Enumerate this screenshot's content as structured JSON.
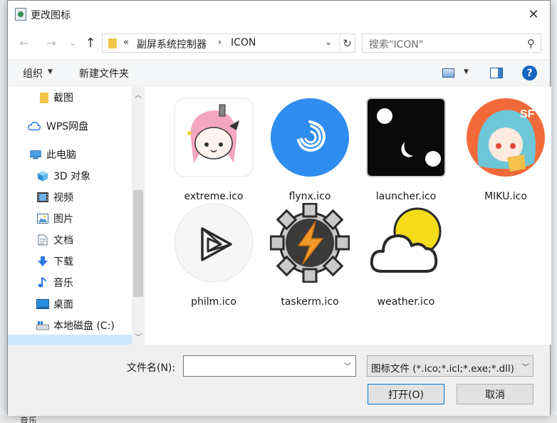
{
  "window": {
    "title": "更改图标"
  },
  "navigation": {
    "back_icon": "←",
    "forward_icon": "→",
    "recent_icon": "⌄",
    "up_icon": "↑"
  },
  "address": {
    "overflow": "«",
    "crumbs": [
      "副屏系统控制器",
      "ICON"
    ],
    "separator": "›"
  },
  "search": {
    "placeholder": "搜索\"ICON\""
  },
  "toolbar": {
    "organize_label": "组织",
    "new_folder_label": "新建文件夹",
    "help_label": "?"
  },
  "sidebar": {
    "items": [
      {
        "label": "截图",
        "icon": "folder-icon"
      },
      {
        "label": "WPS网盘",
        "icon": "cloud-icon"
      },
      {
        "label": "此电脑",
        "icon": "computer-icon"
      },
      {
        "label": "3D 对象",
        "icon": "cube-icon"
      },
      {
        "label": "视频",
        "icon": "film-icon"
      },
      {
        "label": "图片",
        "icon": "picture-icon"
      },
      {
        "label": "文档",
        "icon": "document-icon"
      },
      {
        "label": "下载",
        "icon": "download-icon"
      },
      {
        "label": "音乐",
        "icon": "music-icon"
      },
      {
        "label": "桌面",
        "icon": "desktop-icon"
      },
      {
        "label": "本地磁盘 (C:)",
        "icon": "drive-icon"
      }
    ]
  },
  "files": [
    {
      "name": "extreme.ico",
      "icon": "anime-girl-icon"
    },
    {
      "name": "flynx.ico",
      "icon": "spiral-icon"
    },
    {
      "name": "launcher.ico",
      "icon": "moon-dots-icon"
    },
    {
      "name": "MIKU.ico",
      "icon": "miku-icon"
    },
    {
      "name": "philm.ico",
      "icon": "triangle-icon"
    },
    {
      "name": "taskerm.ico",
      "icon": "gear-bolt-icon"
    },
    {
      "name": "weather.ico",
      "icon": "cloud-sun-icon"
    }
  ],
  "footer": {
    "filename_label": "文件名(N):",
    "filename_value": "",
    "filetype_value": "图标文件 (*.ico;*.icl;*.exe;*.dll)",
    "open_label": "打开(O)",
    "cancel_label": "取消"
  },
  "background": {
    "bottom_text": "音乐"
  },
  "colors": {
    "accent": "#0078d7",
    "selection": "#cce8ff",
    "flynx_blue": "#2f8cf0",
    "help_blue": "#1565c0"
  }
}
